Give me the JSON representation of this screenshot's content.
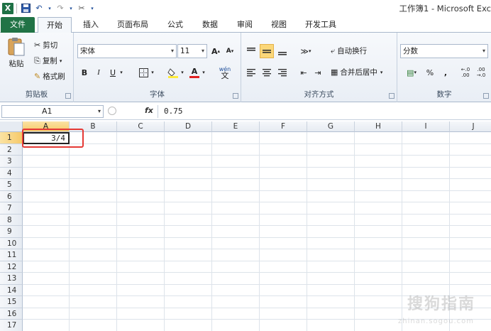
{
  "window": {
    "title": "工作簿1 - Microsoft Exc"
  },
  "tabs": [
    "文件",
    "开始",
    "插入",
    "页面布局",
    "公式",
    "数据",
    "审阅",
    "视图",
    "开发工具"
  ],
  "clipboard": {
    "paste": "粘贴",
    "cut": "剪切",
    "copy": "复制",
    "format_painter": "格式刷",
    "label": "剪贴板"
  },
  "font": {
    "name": "宋体",
    "size": "11",
    "label": "字体",
    "bold": "B",
    "italic": "I",
    "underline": "U",
    "grow": "A",
    "shrink": "A",
    "font_color": "A",
    "wen": "wén"
  },
  "alignment": {
    "wrap": "自动换行",
    "merge": "合并后居中",
    "label": "对齐方式"
  },
  "number": {
    "format": "分数",
    "percent": "%",
    "comma": ",",
    "label": "数字"
  },
  "formula_bar": {
    "name_box": "A1",
    "fx": "fx",
    "value": "0.75"
  },
  "columns": [
    "A",
    "B",
    "C",
    "D",
    "E",
    "F",
    "G",
    "H",
    "I",
    "J"
  ],
  "rows": [
    "1",
    "2",
    "3",
    "4",
    "5",
    "6",
    "7",
    "8",
    "9",
    "10",
    "11",
    "12",
    "13",
    "14",
    "15",
    "16",
    "17"
  ],
  "cell_a1": "3/4",
  "watermark": {
    "text": "搜狗指南",
    "sub": "zhinan.sogou.com"
  }
}
